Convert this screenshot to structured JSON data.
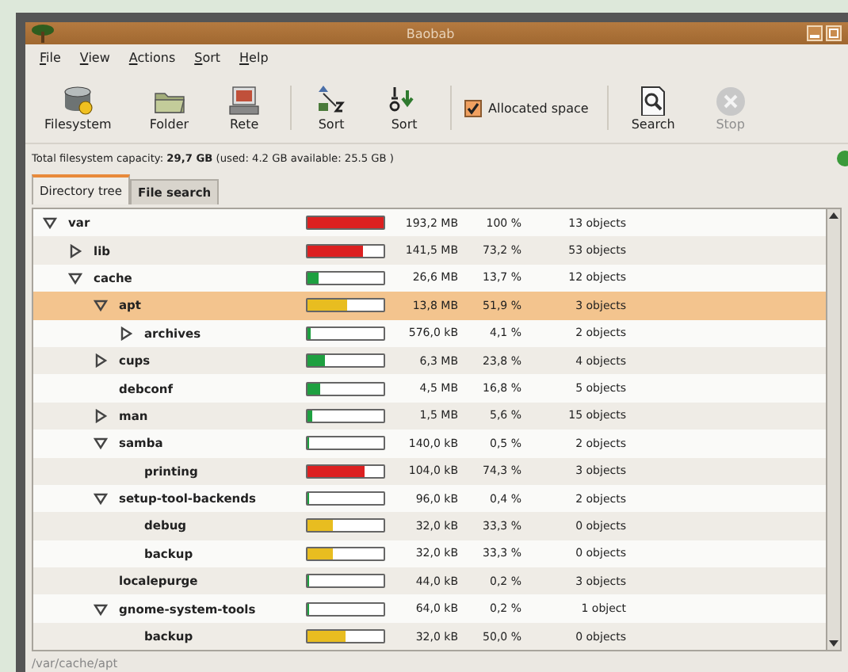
{
  "window": {
    "title": "Baobab"
  },
  "menu": [
    {
      "label": "File"
    },
    {
      "label": "View"
    },
    {
      "label": "Actions"
    },
    {
      "label": "Sort"
    },
    {
      "label": "Help"
    }
  ],
  "toolbar": [
    {
      "kind": "button",
      "label": "Filesystem",
      "disabled": false
    },
    {
      "kind": "button",
      "label": "Folder",
      "disabled": false
    },
    {
      "kind": "button",
      "label": "Rete",
      "disabled": false
    },
    {
      "kind": "separator"
    },
    {
      "kind": "button",
      "label": "Sort",
      "disabled": false
    },
    {
      "kind": "button",
      "label": "Sort",
      "disabled": false
    },
    {
      "kind": "separator"
    },
    {
      "kind": "checkbox",
      "label": "Allocated space",
      "checked": true
    },
    {
      "kind": "separator"
    },
    {
      "kind": "button",
      "label": "Search",
      "disabled": false
    },
    {
      "kind": "button",
      "label": "Stop",
      "disabled": true
    }
  ],
  "capacity": "Total filesystem capacity: **29,7 GB** (used: 4.2 GB available: 25.5 GB )",
  "tabs": [
    {
      "label": "Directory tree",
      "selected": true
    },
    {
      "label": "File search",
      "selected": false
    }
  ],
  "tree": [
    {
      "name": "var",
      "expanded": true,
      "selected": false,
      "level": 1,
      "size": "193,2 MB",
      "percent": "100 %",
      "objects": "13 objects",
      "children": [
        {
          "name": "lib",
          "expanded": false,
          "selected": false,
          "level": 0.732,
          "size": "141,5 MB",
          "percent": "73,2 %",
          "objects": "53 objects"
        },
        {
          "name": "cache",
          "expanded": true,
          "selected": false,
          "level": 0.137,
          "size": "26,6 MB",
          "percent": "13,7 %",
          "objects": "12 objects",
          "children": [
            {
              "name": "apt",
              "expanded": true,
              "selected": true,
              "level": 0.519,
              "size": "13,8 MB",
              "percent": "51,9 %",
              "objects": "3 objects",
              "children": [
                {
                  "name": "archives",
                  "expanded": false,
                  "selected": false,
                  "level": 0.041,
                  "size": "576,0 kB",
                  "percent": "4,1 %",
                  "objects": "2 objects"
                }
              ]
            },
            {
              "name": "cups",
              "expanded": false,
              "selected": false,
              "level": 0.238,
              "size": "6,3 MB",
              "percent": "23,8 %",
              "objects": "4 objects"
            },
            {
              "name": "debconf",
              "selected": false,
              "level": 0.168,
              "size": "4,5 MB",
              "percent": "16,8 %",
              "objects": "5 objects"
            },
            {
              "name": "man",
              "expanded": false,
              "selected": false,
              "level": 0.056,
              "size": "1,5 MB",
              "percent": "5,6 %",
              "objects": "15 objects"
            },
            {
              "name": "samba",
              "expanded": true,
              "selected": false,
              "level": 0.005,
              "size": "140,0 kB",
              "percent": "0,5 %",
              "objects": "2 objects",
              "children": [
                {
                  "name": "printing",
                  "selected": false,
                  "level": 0.743,
                  "size": "104,0 kB",
                  "percent": "74,3 %",
                  "objects": "3 objects"
                }
              ]
            },
            {
              "name": "setup-tool-backends",
              "expanded": true,
              "selected": false,
              "level": 0.004,
              "size": "96,0 kB",
              "percent": "0,4 %",
              "objects": "2 objects",
              "children": [
                {
                  "name": "debug",
                  "selected": false,
                  "level": 0.333,
                  "size": "32,0 kB",
                  "percent": "33,3 %",
                  "objects": "0 objects"
                },
                {
                  "name": "backup",
                  "selected": false,
                  "level": 0.333,
                  "size": "32,0 kB",
                  "percent": "33,3 %",
                  "objects": "0 objects"
                }
              ]
            },
            {
              "name": "localepurge",
              "selected": false,
              "level": 0.002,
              "size": "44,0 kB",
              "percent": "0,2 %",
              "objects": "3 objects"
            },
            {
              "name": "gnome-system-tools",
              "expanded": true,
              "selected": false,
              "level": 0.002,
              "size": "64,0 kB",
              "percent": "0,2 %",
              "objects": "1 object",
              "children": [
                {
                  "name": "backup",
                  "selected": false,
                  "level": 0.5,
                  "size": "32,0 kB",
                  "percent": "50,0 %",
                  "objects": "0 objects"
                }
              ]
            }
          ]
        }
      ]
    }
  ],
  "status_bar": "/var/cache/apt"
}
